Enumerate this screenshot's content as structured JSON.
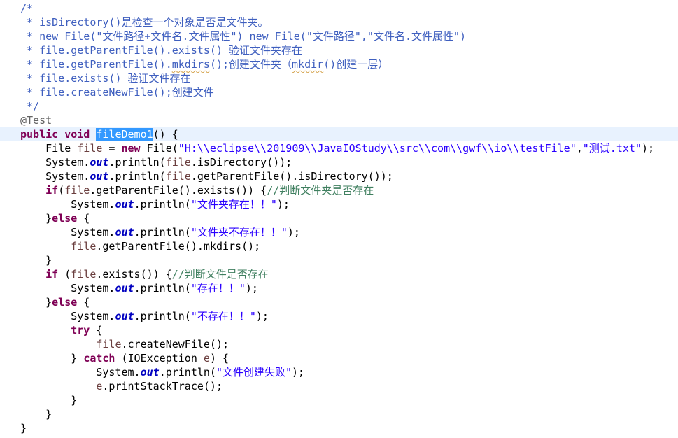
{
  "editor": {
    "method_name": "fileDemo1",
    "lines": [
      [
        {
          "t": "/*",
          "c": "comment"
        }
      ],
      [
        {
          "t": " * isDirectory()是检查一个对象是否是文件夹。",
          "c": "comment"
        }
      ],
      [
        {
          "t": " * new File(\"文件路径+文件名.文件属性\") new File(\"文件路径\",\"文件名.文件属性\")",
          "c": "comment"
        }
      ],
      [
        {
          "t": " * file.getParentFile().exists() 验证文件夹存在",
          "c": "comment"
        }
      ],
      [
        {
          "t": " * file.getParentFile().",
          "c": "comment"
        },
        {
          "t": "mkdirs",
          "c": "comment spell"
        },
        {
          "t": "();创建文件夹（",
          "c": "comment"
        },
        {
          "t": "mkdir",
          "c": "comment spell"
        },
        {
          "t": "()创建一层）",
          "c": "comment"
        }
      ],
      [
        {
          "t": " * file.exists() 验证文件存在",
          "c": "comment"
        }
      ],
      [
        {
          "t": " * file.createNewFile();创建文件",
          "c": "comment"
        }
      ],
      [
        {
          "t": " */",
          "c": "comment"
        }
      ],
      [
        {
          "t": "@Test",
          "c": "ann"
        }
      ],
      [
        {
          "t": "public",
          "c": "kw"
        },
        {
          "t": " "
        },
        {
          "t": "void",
          "c": "kw"
        },
        {
          "t": " "
        },
        {
          "t": "fileDemo1",
          "c": "sel"
        },
        {
          "t": "() {"
        }
      ],
      [
        {
          "t": "    File "
        },
        {
          "t": "file",
          "c": "var"
        },
        {
          "t": " = "
        },
        {
          "t": "new",
          "c": "kw"
        },
        {
          "t": " File("
        },
        {
          "t": "\"H:\\\\eclipse\\\\201909\\\\JavaIOStudy\\\\src\\\\com\\\\gwf\\\\io\\\\testFile\"",
          "c": "str"
        },
        {
          "t": ","
        },
        {
          "t": "\"测试.txt\"",
          "c": "str"
        },
        {
          "t": ");"
        }
      ],
      [
        {
          "t": "    System."
        },
        {
          "t": "out",
          "c": "field"
        },
        {
          "t": ".println("
        },
        {
          "t": "file",
          "c": "var"
        },
        {
          "t": ".isDirectory());"
        }
      ],
      [
        {
          "t": "    System."
        },
        {
          "t": "out",
          "c": "field"
        },
        {
          "t": ".println("
        },
        {
          "t": "file",
          "c": "var"
        },
        {
          "t": ".getParentFile().isDirectory());"
        }
      ],
      [
        {
          "t": "    "
        },
        {
          "t": "if",
          "c": "kw"
        },
        {
          "t": "("
        },
        {
          "t": "file",
          "c": "var"
        },
        {
          "t": ".getParentFile().exists()) {"
        },
        {
          "t": "//判断文件夹是否存在",
          "c": "line-comment"
        }
      ],
      [
        {
          "t": "        System."
        },
        {
          "t": "out",
          "c": "field"
        },
        {
          "t": ".println("
        },
        {
          "t": "\"文件夹存在！！\"",
          "c": "str"
        },
        {
          "t": ");"
        }
      ],
      [
        {
          "t": "    }"
        },
        {
          "t": "else",
          "c": "kw"
        },
        {
          "t": " {"
        }
      ],
      [
        {
          "t": "        System."
        },
        {
          "t": "out",
          "c": "field"
        },
        {
          "t": ".println("
        },
        {
          "t": "\"文件夹不存在！！\"",
          "c": "str"
        },
        {
          "t": ");"
        }
      ],
      [
        {
          "t": "        "
        },
        {
          "t": "file",
          "c": "var"
        },
        {
          "t": ".getParentFile().mkdirs();"
        }
      ],
      [
        {
          "t": "    }"
        }
      ],
      [
        {
          "t": "    "
        },
        {
          "t": "if",
          "c": "kw"
        },
        {
          "t": " ("
        },
        {
          "t": "file",
          "c": "var"
        },
        {
          "t": ".exists()) {"
        },
        {
          "t": "//判断文件是否存在",
          "c": "line-comment"
        }
      ],
      [
        {
          "t": "        System."
        },
        {
          "t": "out",
          "c": "field"
        },
        {
          "t": ".println("
        },
        {
          "t": "\"存在！！\"",
          "c": "str"
        },
        {
          "t": ");"
        }
      ],
      [
        {
          "t": "    }"
        },
        {
          "t": "else",
          "c": "kw"
        },
        {
          "t": " {"
        }
      ],
      [
        {
          "t": "        System."
        },
        {
          "t": "out",
          "c": "field"
        },
        {
          "t": ".println("
        },
        {
          "t": "\"不存在！！\"",
          "c": "str"
        },
        {
          "t": ");"
        }
      ],
      [
        {
          "t": "        "
        },
        {
          "t": "try",
          "c": "kw"
        },
        {
          "t": " {"
        }
      ],
      [
        {
          "t": "            "
        },
        {
          "t": "file",
          "c": "var"
        },
        {
          "t": ".createNewFile();"
        }
      ],
      [
        {
          "t": "        } "
        },
        {
          "t": "catch",
          "c": "kw"
        },
        {
          "t": " (IOException "
        },
        {
          "t": "e",
          "c": "var"
        },
        {
          "t": ") {"
        }
      ],
      [
        {
          "t": "            System."
        },
        {
          "t": "out",
          "c": "field"
        },
        {
          "t": ".println("
        },
        {
          "t": "\"文件创建失败\"",
          "c": "str"
        },
        {
          "t": ");"
        }
      ],
      [
        {
          "t": "            "
        },
        {
          "t": "e",
          "c": "var"
        },
        {
          "t": ".printStackTrace();"
        }
      ],
      [
        {
          "t": "        }"
        }
      ],
      [
        {
          "t": "    }"
        }
      ],
      [
        {
          "t": "}"
        }
      ]
    ]
  }
}
